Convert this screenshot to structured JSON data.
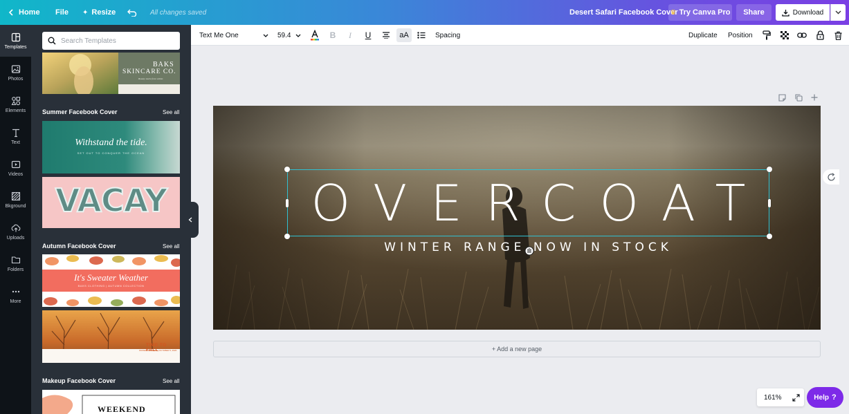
{
  "topbar": {
    "home_label": "Home",
    "file_label": "File",
    "resize_label": "Resize",
    "saved_status": "All changes saved",
    "doc_title": "Desert Safari Facebook Cover",
    "try_pro_label": "Try Canva Pro",
    "share_label": "Share",
    "download_label": "Download"
  },
  "rail": {
    "items": [
      {
        "label": "Templates",
        "icon": "templates-icon"
      },
      {
        "label": "Photos",
        "icon": "photos-icon"
      },
      {
        "label": "Elements",
        "icon": "elements-icon"
      },
      {
        "label": "Text",
        "icon": "text-icon"
      },
      {
        "label": "Videos",
        "icon": "videos-icon"
      },
      {
        "label": "Bkground",
        "icon": "background-icon"
      },
      {
        "label": "Uploads",
        "icon": "uploads-icon"
      },
      {
        "label": "Folders",
        "icon": "folders-icon"
      },
      {
        "label": "More",
        "icon": "more-icon"
      }
    ]
  },
  "panel": {
    "search_placeholder": "Search Templates",
    "sections": [
      {
        "title": "Summer Facebook Cover",
        "see_all": "See all"
      },
      {
        "title": "Autumn Facebook Cover",
        "see_all": "See all"
      },
      {
        "title": "Makeup Facebook Cover",
        "see_all": "See all"
      }
    ],
    "thumbs": {
      "baks_title": "BAKS",
      "baks_sub": "SKINCARE CO.",
      "baks_tag": "Beauty starts from within",
      "tide_title": "Withstand the tide.",
      "tide_sub": "SET OUT TO CONQUER THE OCEAN",
      "vacay": "VACAY",
      "sweater_title": "It's Sweater Weather",
      "sweater_sub": "BAKS CLOTHING | AUTUMN COLLECTION",
      "fall_title": "TIME TO FALL",
      "fall_sub": "WATERSIDE PARK | OCTOBER 5, 2020",
      "weekend": "WEEKEND"
    }
  },
  "toolbar": {
    "font_name": "Text Me One",
    "font_size": "59.4",
    "case_label": "aA",
    "spacing_label": "Spacing",
    "duplicate_label": "Duplicate",
    "position_label": "Position"
  },
  "canvas": {
    "headline": "OVERCOAT",
    "subline": "WINTER RANGE NOW IN STOCK",
    "add_page_label": "+ Add a new page"
  },
  "footer": {
    "zoom": "161%",
    "help_label": "Help",
    "help_mark": "?"
  },
  "colors": {
    "accent": "#7d2ae8",
    "selection": "#30c1d2",
    "panel_bg": "#293039",
    "rail_bg": "#0e1318"
  }
}
